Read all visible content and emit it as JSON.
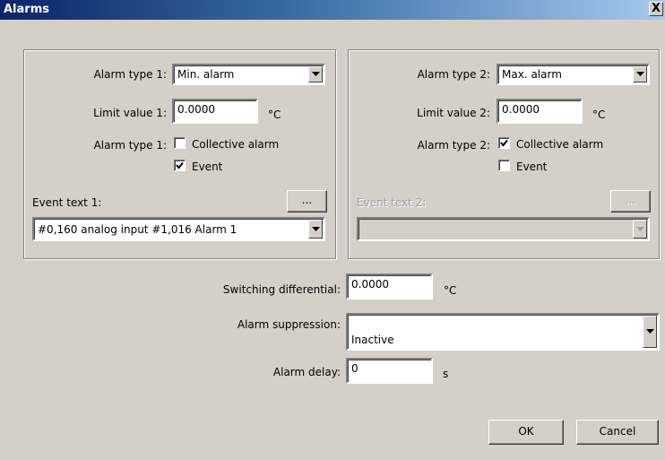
{
  "window": {
    "title": "Alarms",
    "close_glyph": "X"
  },
  "alarm1": {
    "type_label": "Alarm type 1:",
    "type_value": "Min. alarm",
    "limit_label": "Limit value 1:",
    "limit_value": "0.0000",
    "limit_unit": "°C",
    "collective_label": "Alarm type 1:",
    "collective_text": "Collective alarm",
    "collective_checked": false,
    "event_text": "Event",
    "event_checked": true,
    "event_text_label": "Event text 1:",
    "event_text_button": "...",
    "event_text_value": "#0,160 analog input #1,016 Alarm 1"
  },
  "alarm2": {
    "type_label": "Alarm type 2:",
    "type_value": "Max. alarm",
    "limit_label": "Limit value 2:",
    "limit_value": "0.0000",
    "limit_unit": "°C",
    "collective_label": "Alarm type 2:",
    "collective_text": "Collective alarm",
    "collective_checked": true,
    "event_text": "Event",
    "event_checked": false,
    "event_text_label": "Event text 2:",
    "event_text_button": "...",
    "event_text_value": ""
  },
  "common": {
    "switching_label": "Switching differential:",
    "switching_value": "0.0000",
    "switching_unit": "°C",
    "suppression_label": "Alarm suppression:",
    "suppression_value": "Inactive",
    "delay_label": "Alarm delay:",
    "delay_value": "0",
    "delay_unit": "s"
  },
  "buttons": {
    "ok": "OK",
    "cancel": "Cancel"
  }
}
